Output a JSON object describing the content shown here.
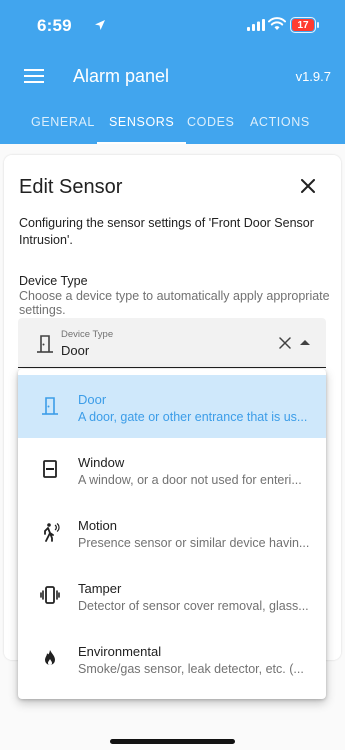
{
  "status_bar": {
    "time": "6:59",
    "battery": "17",
    "battery_color": "#ff3b30"
  },
  "header": {
    "title": "Alarm panel",
    "version": "v1.9.7",
    "accent": "#41a5ee"
  },
  "tabs": [
    {
      "label": "GENERAL",
      "active": false
    },
    {
      "label": "SENSORS",
      "active": true
    },
    {
      "label": "CODES",
      "active": false
    },
    {
      "label": "ACTIONS",
      "active": false
    }
  ],
  "dialog": {
    "title": "Edit Sensor",
    "description": "Configuring the sensor settings of 'Front Door Sensor Intrusion'.",
    "field_label": "Device Type",
    "field_help": "Choose a device type to automatically apply appropriate settings.",
    "select": {
      "label": "Device Type",
      "value": "Door",
      "icon": "door-icon"
    },
    "options": [
      {
        "title": "Door",
        "subtitle": "A door, gate or other entrance that is us...",
        "icon": "door-icon",
        "selected": true
      },
      {
        "title": "Window",
        "subtitle": "A window, or a door not used for enteri...",
        "icon": "window-icon",
        "selected": false
      },
      {
        "title": "Motion",
        "subtitle": "Presence sensor or similar device havin...",
        "icon": "motion-icon",
        "selected": false
      },
      {
        "title": "Tamper",
        "subtitle": "Detector of sensor cover removal, glass...",
        "icon": "vibrate-icon",
        "selected": false
      },
      {
        "title": "Environmental",
        "subtitle": "Smoke/gas sensor, leak detector, etc. (...",
        "icon": "fire-icon",
        "selected": false
      }
    ]
  },
  "colors": {
    "selected_bg": "#cfe8fb",
    "selected_text": "#3c9de8"
  }
}
